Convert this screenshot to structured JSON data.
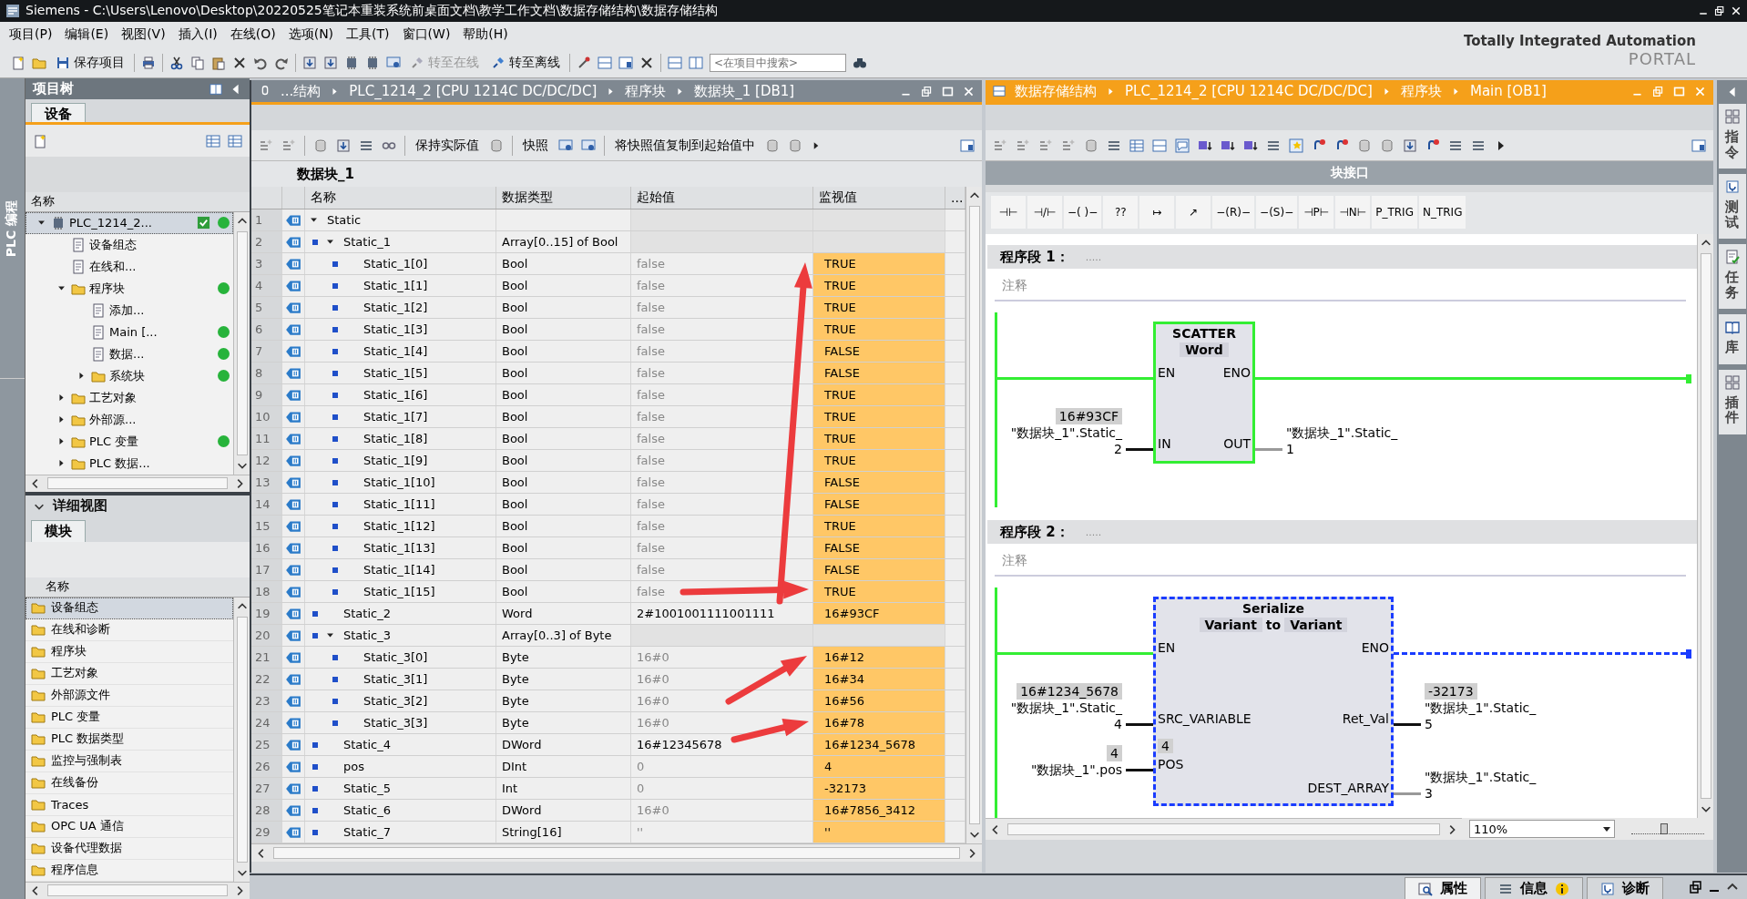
{
  "window": {
    "title": "Siemens  -  C:\\Users\\Lenovo\\Desktop\\20220525笔记本重装系统前桌面文档\\教学工作文档\\数据存储结构\\数据存储结构"
  },
  "menu": [
    "项目(P)",
    "编辑(E)",
    "视图(V)",
    "插入(I)",
    "在线(O)",
    "选项(N)",
    "工具(T)",
    "窗口(W)",
    "帮助(H)"
  ],
  "toolbar": {
    "save_label": "保存项目",
    "go_online": {
      "label": "转至在线",
      "disabled": true
    },
    "go_offline": {
      "label": "转至离线",
      "disabled": false
    },
    "search": {
      "placeholder": "<在项目中搜索>"
    }
  },
  "brand": {
    "line1": "Totally Integrated Automation",
    "line2": "PORTAL"
  },
  "side_strip": {
    "label": "PLC 编程"
  },
  "project_tree": {
    "title": "项目树",
    "tab": "设备",
    "column": "名称",
    "items": [
      {
        "label": "PLC_1214_2...",
        "expanded": true,
        "checked": true,
        "online": true,
        "selected": true,
        "children": [
          {
            "label": "设备组态",
            "online": false,
            "selected": false
          },
          {
            "label": "在线和...",
            "online": false,
            "selected": false
          },
          {
            "label": "程序块",
            "expanded": true,
            "online": true,
            "selected": false,
            "children": [
              {
                "label": "添加...",
                "online": false,
                "selected": false
              },
              {
                "label": "Main [...",
                "online": true,
                "selected": false
              },
              {
                "label": "数据...",
                "online": true,
                "selected": false
              },
              {
                "label": "系统块",
                "expanded": false,
                "online": true,
                "selected": false
              }
            ]
          },
          {
            "label": "工艺对象",
            "expanded": false,
            "online": false,
            "selected": false
          },
          {
            "label": "外部源...",
            "expanded": false,
            "online": false,
            "selected": false
          },
          {
            "label": "PLC 变量",
            "expanded": false,
            "online": true,
            "selected": false
          },
          {
            "label": "PLC 数据...",
            "expanded": false,
            "online": false,
            "selected": false
          }
        ]
      }
    ]
  },
  "detail_view": {
    "title": "详细视图",
    "tab": "模块",
    "column": "名称",
    "items": [
      {
        "label": "设备组态",
        "selected": true
      },
      {
        "label": "在线和诊断",
        "selected": false
      },
      {
        "label": "程序块",
        "selected": false
      },
      {
        "label": "工艺对象",
        "selected": false
      },
      {
        "label": "外部源文件",
        "selected": false
      },
      {
        "label": "PLC 变量",
        "selected": false
      },
      {
        "label": "PLC 数据类型",
        "selected": false
      },
      {
        "label": "监控与强制表",
        "selected": false
      },
      {
        "label": "在线备份",
        "selected": false
      },
      {
        "label": "Traces",
        "selected": false
      },
      {
        "label": "OPC UA 通信",
        "selected": false
      },
      {
        "label": "设备代理数据",
        "selected": false
      },
      {
        "label": "程序信息",
        "selected": false
      }
    ]
  },
  "db_editor": {
    "active": false,
    "breadcrumb": [
      "...结构",
      "PLC_1214_2 [CPU 1214C DC/DC/DC]",
      "程序块",
      "数据块_1 [DB1]"
    ],
    "toolbar": [
      "保持实际值",
      "快照",
      "将快照值复制到起始值中"
    ],
    "title": "数据块_1",
    "columns": [
      "名称",
      "数据类型",
      "起始值",
      "监视值",
      "..."
    ],
    "rows": [
      {
        "no": "1",
        "name": "Static",
        "expanded": true,
        "children": [
          {
            "no": "2",
            "name": "Static_1",
            "type": "Array[0..15] of Bool",
            "expanded": true,
            "children": [
              {
                "no": "3",
                "name": "Static_1[0]",
                "type": "Bool",
                "start": "false",
                "start_muted": true,
                "monitor": "TRUE"
              },
              {
                "no": "4",
                "name": "Static_1[1]",
                "type": "Bool",
                "start": "false",
                "start_muted": true,
                "monitor": "TRUE"
              },
              {
                "no": "5",
                "name": "Static_1[2]",
                "type": "Bool",
                "start": "false",
                "start_muted": true,
                "monitor": "TRUE"
              },
              {
                "no": "6",
                "name": "Static_1[3]",
                "type": "Bool",
                "start": "false",
                "start_muted": true,
                "monitor": "TRUE"
              },
              {
                "no": "7",
                "name": "Static_1[4]",
                "type": "Bool",
                "start": "false",
                "start_muted": true,
                "monitor": "FALSE"
              },
              {
                "no": "8",
                "name": "Static_1[5]",
                "type": "Bool",
                "start": "false",
                "start_muted": true,
                "monitor": "FALSE"
              },
              {
                "no": "9",
                "name": "Static_1[6]",
                "type": "Bool",
                "start": "false",
                "start_muted": true,
                "monitor": "TRUE"
              },
              {
                "no": "10",
                "name": "Static_1[7]",
                "type": "Bool",
                "start": "false",
                "start_muted": true,
                "monitor": "TRUE"
              },
              {
                "no": "11",
                "name": "Static_1[8]",
                "type": "Bool",
                "start": "false",
                "start_muted": true,
                "monitor": "TRUE"
              },
              {
                "no": "12",
                "name": "Static_1[9]",
                "type": "Bool",
                "start": "false",
                "start_muted": true,
                "monitor": "TRUE"
              },
              {
                "no": "13",
                "name": "Static_1[10]",
                "type": "Bool",
                "start": "false",
                "start_muted": true,
                "monitor": "FALSE"
              },
              {
                "no": "14",
                "name": "Static_1[11]",
                "type": "Bool",
                "start": "false",
                "start_muted": true,
                "monitor": "FALSE"
              },
              {
                "no": "15",
                "name": "Static_1[12]",
                "type": "Bool",
                "start": "false",
                "start_muted": true,
                "monitor": "TRUE"
              },
              {
                "no": "16",
                "name": "Static_1[13]",
                "type": "Bool",
                "start": "false",
                "start_muted": true,
                "monitor": "FALSE"
              },
              {
                "no": "17",
                "name": "Static_1[14]",
                "type": "Bool",
                "start": "false",
                "start_muted": true,
                "monitor": "FALSE"
              },
              {
                "no": "18",
                "name": "Static_1[15]",
                "type": "Bool",
                "start": "false",
                "start_muted": true,
                "monitor": "TRUE"
              }
            ]
          },
          {
            "no": "19",
            "name": "Static_2",
            "type": "Word",
            "start": "2#1001001111001111",
            "start_muted": false,
            "monitor": "16#93CF"
          },
          {
            "no": "20",
            "name": "Static_3",
            "type": "Array[0..3] of Byte",
            "expanded": true,
            "children": [
              {
                "no": "21",
                "name": "Static_3[0]",
                "type": "Byte",
                "start": "16#0",
                "start_muted": true,
                "monitor": "16#12"
              },
              {
                "no": "22",
                "name": "Static_3[1]",
                "type": "Byte",
                "start": "16#0",
                "start_muted": true,
                "monitor": "16#34"
              },
              {
                "no": "23",
                "name": "Static_3[2]",
                "type": "Byte",
                "start": "16#0",
                "start_muted": true,
                "monitor": "16#56"
              },
              {
                "no": "24",
                "name": "Static_3[3]",
                "type": "Byte",
                "start": "16#0",
                "start_muted": true,
                "monitor": "16#78"
              }
            ]
          },
          {
            "no": "25",
            "name": "Static_4",
            "type": "DWord",
            "start": "16#12345678",
            "start_muted": false,
            "monitor": "16#1234_5678"
          },
          {
            "no": "26",
            "name": "pos",
            "type": "DInt",
            "start": "0",
            "start_muted": true,
            "monitor": "4"
          },
          {
            "no": "27",
            "name": "Static_5",
            "type": "Int",
            "start": "0",
            "start_muted": true,
            "monitor": "-32173"
          },
          {
            "no": "28",
            "name": "Static_6",
            "type": "DWord",
            "start": "16#0",
            "start_muted": true,
            "monitor": "16#7856_3412"
          },
          {
            "no": "29",
            "name": "Static_7",
            "type": "String[16]",
            "start": "''",
            "start_muted": true,
            "monitor": "''"
          }
        ]
      }
    ]
  },
  "lad_editor": {
    "active": true,
    "breadcrumb": [
      "数据存储结构",
      "PLC_1214_2 [CPU 1214C DC/DC/DC]",
      "程序块",
      "Main [OB1]"
    ],
    "interface_label": "块接口",
    "palette": [
      "⊣⊢",
      "⊣/⊢",
      "−( )−",
      "??",
      "↦",
      "↗",
      "−(R)−",
      "−(S)−",
      "⊣P⊢",
      "⊣N⊢",
      "P_TRIG",
      "N_TRIG"
    ],
    "networks": [
      {
        "title": "程序段 1：",
        "dots": ".....",
        "comment": "注释",
        "box_executed": true,
        "box": {
          "name": "SCATTER",
          "type_parts": [
            {
              "kind": "type",
              "text": "Word"
            }
          ],
          "inputs": [
            {
              "pin": "EN"
            },
            {
              "pin": "IN",
              "value": "16#93CF",
              "operand": "\"数据块_1\".Static_",
              "operand_end": "2"
            }
          ],
          "outputs": [
            {
              "pin": "ENO"
            },
            {
              "pin": "OUT",
              "operand": "\"数据块_1\".Static_",
              "operand_end": "1"
            }
          ]
        }
      },
      {
        "title": "程序段 2：",
        "dots": ".....",
        "comment": "注释",
        "box_executed": false,
        "box": {
          "name": "Serialize",
          "type_parts": [
            {
              "kind": "type",
              "text": "Variant"
            },
            {
              "kind": "word",
              "text": "to"
            },
            {
              "kind": "type",
              "text": "Variant"
            }
          ],
          "inputs": [
            {
              "pin": "EN"
            },
            {
              "pin": "SRC_VARIABLE",
              "value": "16#1234_5678",
              "operand": "\"数据块_1\".Static_",
              "operand_end": "4"
            },
            {
              "pin": "POS",
              "value": "4",
              "operand": "\"数据块_1\".pos",
              "inner_value": "4"
            }
          ],
          "outputs": [
            {
              "pin": "ENO"
            },
            {
              "pin": "Ret_Val",
              "value": "-32173",
              "operand": "\"数据块_1\".Static_",
              "operand_end": "5"
            },
            {
              "pin": "DEST_ARRAY",
              "operand": "\"数据块_1\".Static_",
              "operand_end": "3"
            }
          ]
        }
      }
    ],
    "zoom": "110%",
    "zoom_slider": {
      "level": 0.45
    }
  },
  "task_cards": [
    {
      "label": "指令"
    },
    {
      "label": "测试"
    },
    {
      "label": "任务"
    },
    {
      "label": "库"
    },
    {
      "label": "插件"
    }
  ],
  "status_tabs": [
    {
      "label": "属性",
      "selected": true
    },
    {
      "label": "信息",
      "selected": false
    },
    {
      "label": "诊断",
      "selected": false
    }
  ]
}
